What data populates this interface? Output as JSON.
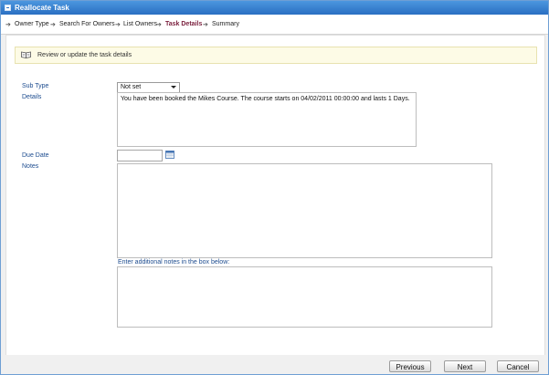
{
  "window": {
    "title": "Reallocate Task"
  },
  "breadcrumb": {
    "steps": [
      "Owner Type",
      "Search For Owners",
      "List Owners",
      "Task Details",
      "Summary"
    ]
  },
  "info": {
    "text": "Review or update the task details"
  },
  "form": {
    "sub_type_label": "Sub Type",
    "sub_type_value": "Not set",
    "details_label": "Details",
    "details_value": "You have been booked the Mikes Course. The course starts on 04/02/2011 00:00:00 and lasts 1 Days.",
    "due_date_label": "Due Date",
    "due_date_value": "",
    "notes_label": "Notes",
    "notes_value": "",
    "additional_notes_hint": "Enter additional notes in the box below:",
    "additional_notes_value": ""
  },
  "footer": {
    "previous_label": "Previous",
    "next_label": "Next",
    "cancel_label": "Cancel"
  },
  "colors": {
    "titlebar": "#2a6fc2",
    "active_step": "#7a1f3d",
    "label": "#1d4c8f",
    "info_background": "#fdfbe6"
  }
}
